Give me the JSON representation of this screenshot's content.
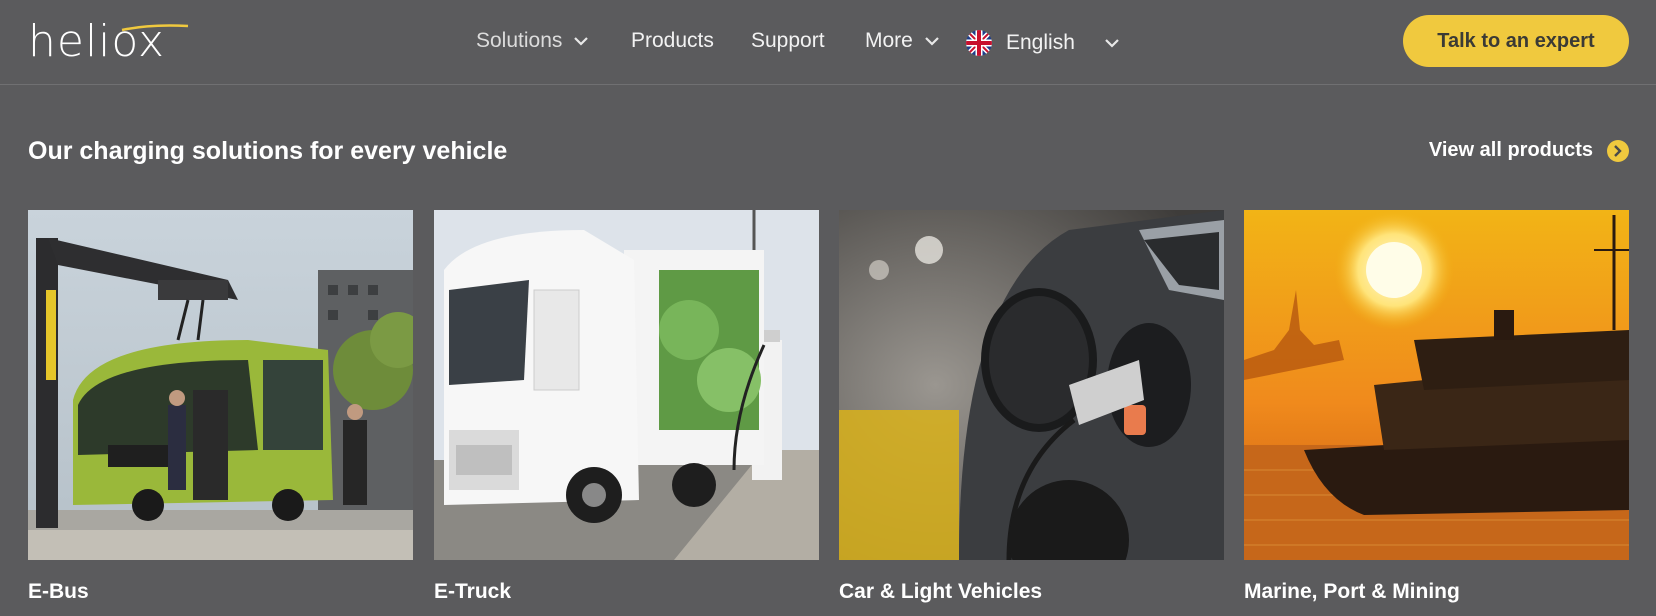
{
  "brand": {
    "logo_text": "heliox"
  },
  "nav": {
    "items": [
      {
        "label": "Solutions",
        "has_dropdown": true
      },
      {
        "label": "Products",
        "has_dropdown": false
      },
      {
        "label": "Support",
        "has_dropdown": false
      },
      {
        "label": "More",
        "has_dropdown": true
      }
    ],
    "language": {
      "label": "English",
      "flag": "uk-flag-icon"
    },
    "cta_label": "Talk to an expert"
  },
  "section": {
    "title": "Our charging solutions for every vehicle",
    "view_all_label": "View all products"
  },
  "cards": [
    {
      "label": "E-Bus",
      "image": "e-bus-charging-photo"
    },
    {
      "label": "E-Truck",
      "image": "e-truck-charging-photo"
    },
    {
      "label": "Car & Light Vehicles",
      "image": "car-charging-photo"
    },
    {
      "label": "Marine, Port & Mining",
      "image": "marine-ferry-sunset-photo"
    }
  ],
  "colors": {
    "background": "#5b5b5d",
    "accent": "#f0c93e",
    "text": "#ffffff"
  }
}
